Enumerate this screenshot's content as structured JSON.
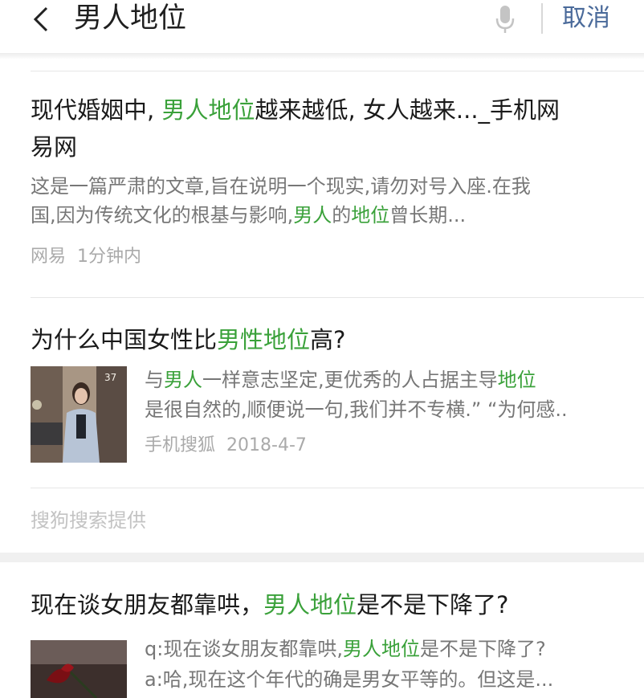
{
  "search": {
    "query": "男人地位",
    "cancel_label": "取消"
  },
  "results": [
    {
      "title_line1": [
        "现代婚姻中, ",
        "男人地位",
        "越来越低, 女人越来..._手机网"
      ],
      "title_line2": "易网",
      "snippet_line1": "这是一篇严肃的文章,旨在说明一个现实,请勿对号入座.在我",
      "snippet_line2": [
        "国,因为传统文化的根基与影响,",
        "男人",
        "的",
        "地位",
        "曾长期..."
      ],
      "source": "网易",
      "time": "1分钟内"
    },
    {
      "title": [
        "为什么中国女性比",
        "男性地位",
        "高?"
      ],
      "snippet_line1": [
        "与",
        "男人",
        "一样意志坚定,更优秀的人占据主导",
        "地位"
      ],
      "snippet_line2": "是很自然的,顺便说一句,我们并不专横.” “为何感..",
      "source": "手机搜狐",
      "date": "2018-4-7",
      "thumb_badge": "37"
    },
    {
      "title": [
        "现在谈女朋友都靠哄，",
        "男人地位",
        "是不是下降了?"
      ],
      "snippet_line1": [
        "q:现在谈女朋友都靠哄,",
        "男人地位",
        "是不是下降了?"
      ],
      "snippet_line2": "a:哈,现在这个年代的确是男女平等的。但这是..."
    }
  ],
  "provider_label": "搜狗搜索提供",
  "colors": {
    "highlight": "#3aa13a",
    "cancel": "#4a6a9a"
  },
  "icons": [
    "back-arrow-icon",
    "microphone-icon"
  ]
}
